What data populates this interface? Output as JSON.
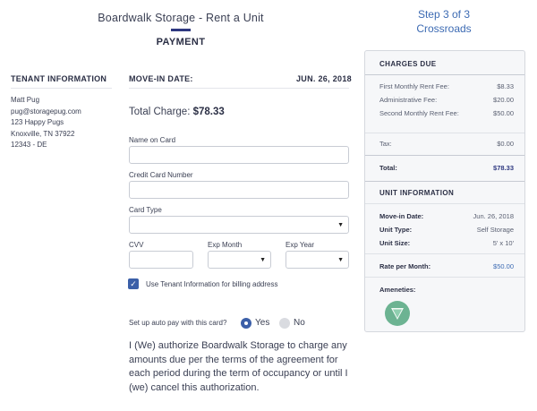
{
  "header": {
    "title": "Boardwalk Storage - Rent a Unit",
    "subtitle": "PAYMENT",
    "step": "Step 3 of 3",
    "location": "Crossroads"
  },
  "tenant": {
    "heading": "TENANT INFORMATION",
    "name": "Matt Pug",
    "email": "pug@storagepug.com",
    "address1": "123 Happy Pugs",
    "address2": "Knoxville, TN 37922",
    "address3": "12343 - DE"
  },
  "move_in": {
    "label": "MOVE-IN DATE:",
    "date": "JUN. 26, 2018"
  },
  "total_charge": {
    "label": "Total Charge:",
    "amount": "$78.33"
  },
  "form": {
    "name_on_card_label": "Name on Card",
    "name_on_card_value": "",
    "credit_card_label": "Credit Card Number",
    "credit_card_value": "",
    "card_type_label": "Card Type",
    "card_type_value": "",
    "cvv_label": "CVV",
    "cvv_value": "",
    "exp_month_label": "Exp Month",
    "exp_month_value": "",
    "exp_year_label": "Exp Year",
    "exp_year_value": "",
    "use_tenant_label": "Use Tenant Information for billing address",
    "use_tenant_checked": true,
    "autopay_question": "Set up auto pay with this card?",
    "autopay_yes": "Yes",
    "autopay_no": "No",
    "autopay_selected": "Yes",
    "authorization": "I (We) authorize Boardwalk Storage to charge any amounts due per the terms of the agreement for each period during the term of occupancy or until I (we) cancel this authorization."
  },
  "charges": {
    "heading": "CHARGES DUE",
    "items": [
      {
        "label": "First Monthly Rent Fee:",
        "value": "$8.33"
      },
      {
        "label": "Administrative Fee:",
        "value": "$20.00"
      },
      {
        "label": "Second Monthly Rent Fee:",
        "value": "$50.00"
      }
    ],
    "tax_label": "Tax:",
    "tax_value": "$0.00",
    "total_label": "Total:",
    "total_value": "$78.33"
  },
  "unit_info": {
    "heading": "UNIT INFORMATION",
    "move_in_label": "Move-in Date:",
    "move_in_value": "Jun. 26, 2018",
    "unit_type_label": "Unit Type:",
    "unit_type_value": "Self Storage",
    "unit_size_label": "Unit Size:",
    "unit_size_value": "5' x 10'",
    "rate_label": "Rate per Month:",
    "rate_value": "$50.00",
    "amenities_label": "Ameneties:",
    "amenity_icon": "amenity-badge-icon"
  },
  "colors": {
    "accent": "#3b5fa8",
    "link": "#3d6bb3",
    "amenity": "#6cb392"
  }
}
